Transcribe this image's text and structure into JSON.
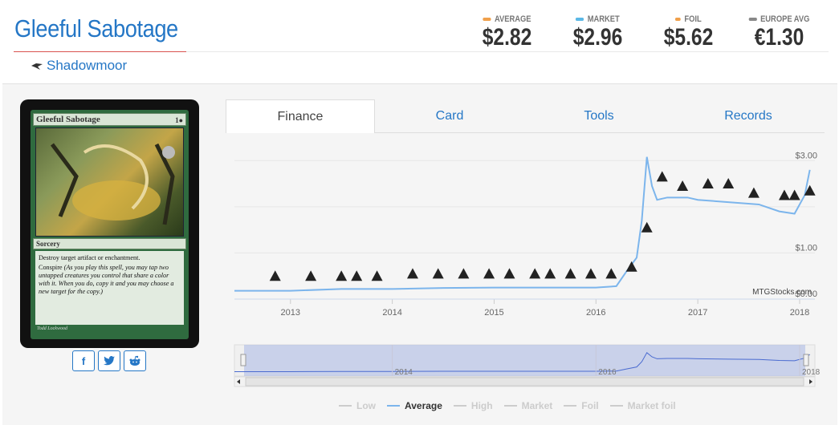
{
  "header": {
    "title": "Gleeful Sabotage",
    "set_name": "Shadowmoor",
    "prices": [
      {
        "label": "AVERAGE",
        "value": "$2.82",
        "color": "#f0a04b"
      },
      {
        "label": "MARKET",
        "value": "$2.96",
        "color": "#5bb8e6"
      },
      {
        "label": "FOIL",
        "value": "$5.62",
        "color": "#f0a04b"
      },
      {
        "label": "EUROPE AVG",
        "value": "€1.30",
        "color": "#888888"
      }
    ]
  },
  "card": {
    "name": "Gleeful Sabotage",
    "cost": "1●",
    "type": "Sorcery",
    "text1": "Destroy target artifact or enchantment.",
    "text2_keyword": "Conspire",
    "text2_reminder": "(As you play this spell, you may tap two untapped creatures you control that share a color with it. When you do, copy it and you may choose a new target for the copy.)",
    "artist": "Todd Lockwood"
  },
  "share": {
    "facebook": "f",
    "twitter": "t",
    "reddit": "r"
  },
  "tabs": [
    {
      "label": "Finance",
      "active": true
    },
    {
      "label": "Card",
      "active": false
    },
    {
      "label": "Tools",
      "active": false
    },
    {
      "label": "Records",
      "active": false
    }
  ],
  "chart_data": {
    "type": "line",
    "y_ticks": [
      "$3.00",
      "$1.00",
      "$0.00"
    ],
    "x_ticks": [
      "2013",
      "2014",
      "2015",
      "2016",
      "2017",
      "2018"
    ],
    "navigator_ticks": [
      "2014",
      "2016",
      "2018"
    ],
    "watermark": "MTGStocks.com",
    "series": [
      {
        "name": "Average",
        "color": "#7cb5ec",
        "x": [
          2012.45,
          2013.0,
          2013.5,
          2014.0,
          2014.5,
          2015.0,
          2015.5,
          2016.0,
          2016.2,
          2016.3,
          2016.4,
          2016.45,
          2016.5,
          2016.55,
          2016.6,
          2016.7,
          2016.8,
          2016.9,
          2017.0,
          2017.3,
          2017.6,
          2017.8,
          2017.95,
          2018.05,
          2018.1
        ],
        "y": [
          0.18,
          0.18,
          0.22,
          0.22,
          0.24,
          0.25,
          0.25,
          0.25,
          0.28,
          0.6,
          0.9,
          1.7,
          3.08,
          2.45,
          2.15,
          2.2,
          2.2,
          2.2,
          2.15,
          2.1,
          2.05,
          1.9,
          1.85,
          2.25,
          2.8
        ]
      }
    ],
    "legend": [
      "Low",
      "Average",
      "High",
      "Market",
      "Foil",
      "Market foil"
    ],
    "legend_active": "Average",
    "ylim": [
      0,
      3.3
    ],
    "xlim": [
      2012.45,
      2018.15
    ]
  }
}
